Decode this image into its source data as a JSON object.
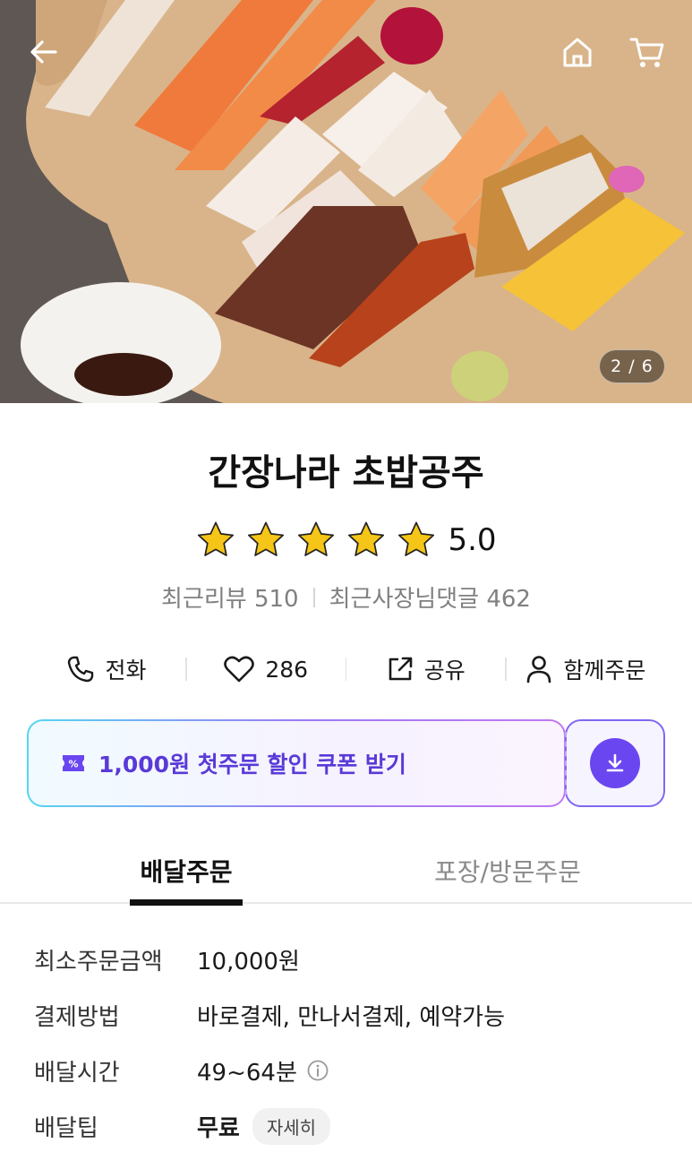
{
  "hero": {
    "page_indicator": "2 / 6",
    "back_icon": "back-arrow-icon",
    "home_icon": "home-icon",
    "cart_icon": "cart-icon"
  },
  "store": {
    "name": "간장나라 초밥공주",
    "rating": "5.0",
    "rating_stars": 5,
    "recent_reviews": "최근리뷰 510",
    "owner_replies": "최근사장님댓글 462"
  },
  "actions": {
    "call": "전화",
    "likes": "286",
    "share": "공유",
    "group_order": "함께주문"
  },
  "coupon": {
    "label": "1,000원 첫주문 할인 쿠폰 받기"
  },
  "tabs": {
    "delivery": "배달주문",
    "pickup": "포장/방문주문"
  },
  "info": {
    "min_order_label": "최소주문금액",
    "min_order_value": "10,000원",
    "payment_label": "결제방법",
    "payment_value": "바로결제, 만나서결제, 예약가능",
    "time_label": "배달시간",
    "time_value": "49~64분",
    "tip_label": "배달팁",
    "tip_value": "무료",
    "tip_detail": "자세히"
  },
  "colors": {
    "accent": "#6a46f0",
    "star": "#f5c518"
  }
}
